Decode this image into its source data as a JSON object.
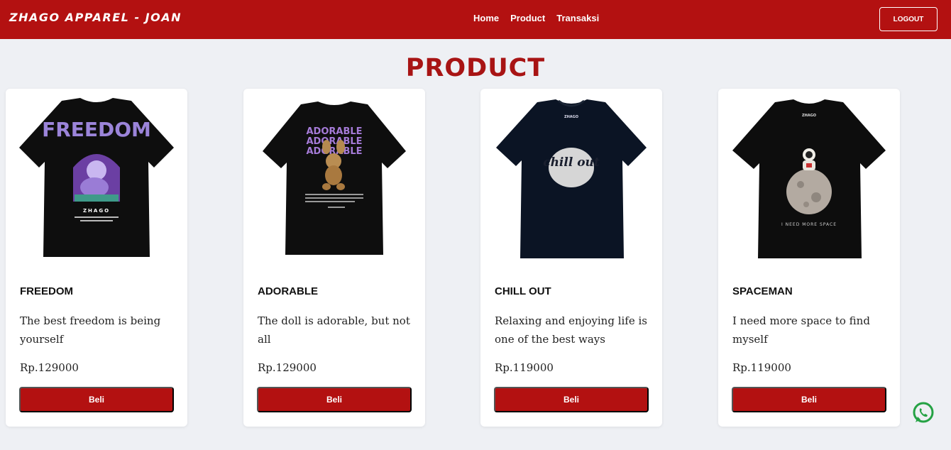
{
  "header": {
    "brand": "ZHAGO APPAREL - JOAN",
    "nav": [
      "Home",
      "Product",
      "Transaksi"
    ],
    "logout_label": "LOGOUT"
  },
  "page_title": "PRODUCT",
  "products": [
    {
      "name": "FREEDOM",
      "description": "The best freedom is being yourself",
      "price": "Rp.129000",
      "buy_label": "Beli",
      "image_text": "FREEDOM",
      "image_sub": "ZHAGO"
    },
    {
      "name": "ADORABLE",
      "description": "The doll is adorable, but not all",
      "price": "Rp.129000",
      "buy_label": "Beli",
      "image_text": "ADORABLE"
    },
    {
      "name": "CHILL OUT",
      "description": "Relaxing and enjoying life is one of the best ways",
      "price": "Rp.119000",
      "buy_label": "Beli",
      "image_text": "chill out",
      "image_sub": "ZHAGO"
    },
    {
      "name": "SPACEMAN",
      "description": "I need more space to find myself",
      "price": "Rp.119000",
      "buy_label": "Beli",
      "image_text": "I NEED MORE SPACE",
      "image_sub": "ZHAGO"
    }
  ],
  "colors": {
    "brand": "#b31111",
    "title": "#a81414",
    "background": "#eef0f4",
    "whatsapp": "#25a244"
  },
  "icons": {
    "floating": "whatsapp-icon"
  }
}
